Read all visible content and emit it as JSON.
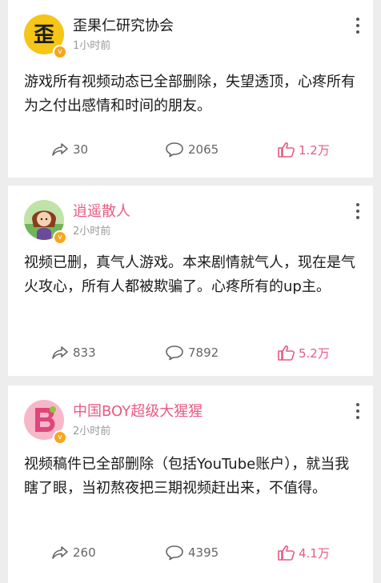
{
  "posts": [
    {
      "author": "歪果仁研究协会",
      "avatar_char": "歪",
      "time": "1小时前",
      "content": "游戏所有视频动态已全部删除，失望透顶，心疼所有为之付出感情和时间的朋友。",
      "shares": "30",
      "comments": "2065",
      "likes": "1.2万"
    },
    {
      "author": "逍遥散人",
      "time": "2小时前",
      "content": "视频已删，真气人游戏。本来剧情就气人，现在是气火攻心，所有人都被欺骗了。心疼所有的up主。",
      "shares": "833",
      "comments": "7892",
      "likes": "5.2万"
    },
    {
      "author": "中国BOY超级大猩猩",
      "time": "2小时前",
      "content": "视频稿件已全部删除（包括YouTube账户），就当我瞎了眼，当初熬夜把三期视频赶出来，不值得。",
      "shares": "260",
      "comments": "4395",
      "likes": "4.1万"
    }
  ],
  "colors": {
    "vip_name": "#e85a82",
    "like": "#e85a82",
    "badge": "#f6a622",
    "background": "#ededed"
  },
  "icons": [
    "more-vertical-icon",
    "share-icon",
    "comment-icon",
    "like-icon",
    "verified-badge-icon"
  ]
}
